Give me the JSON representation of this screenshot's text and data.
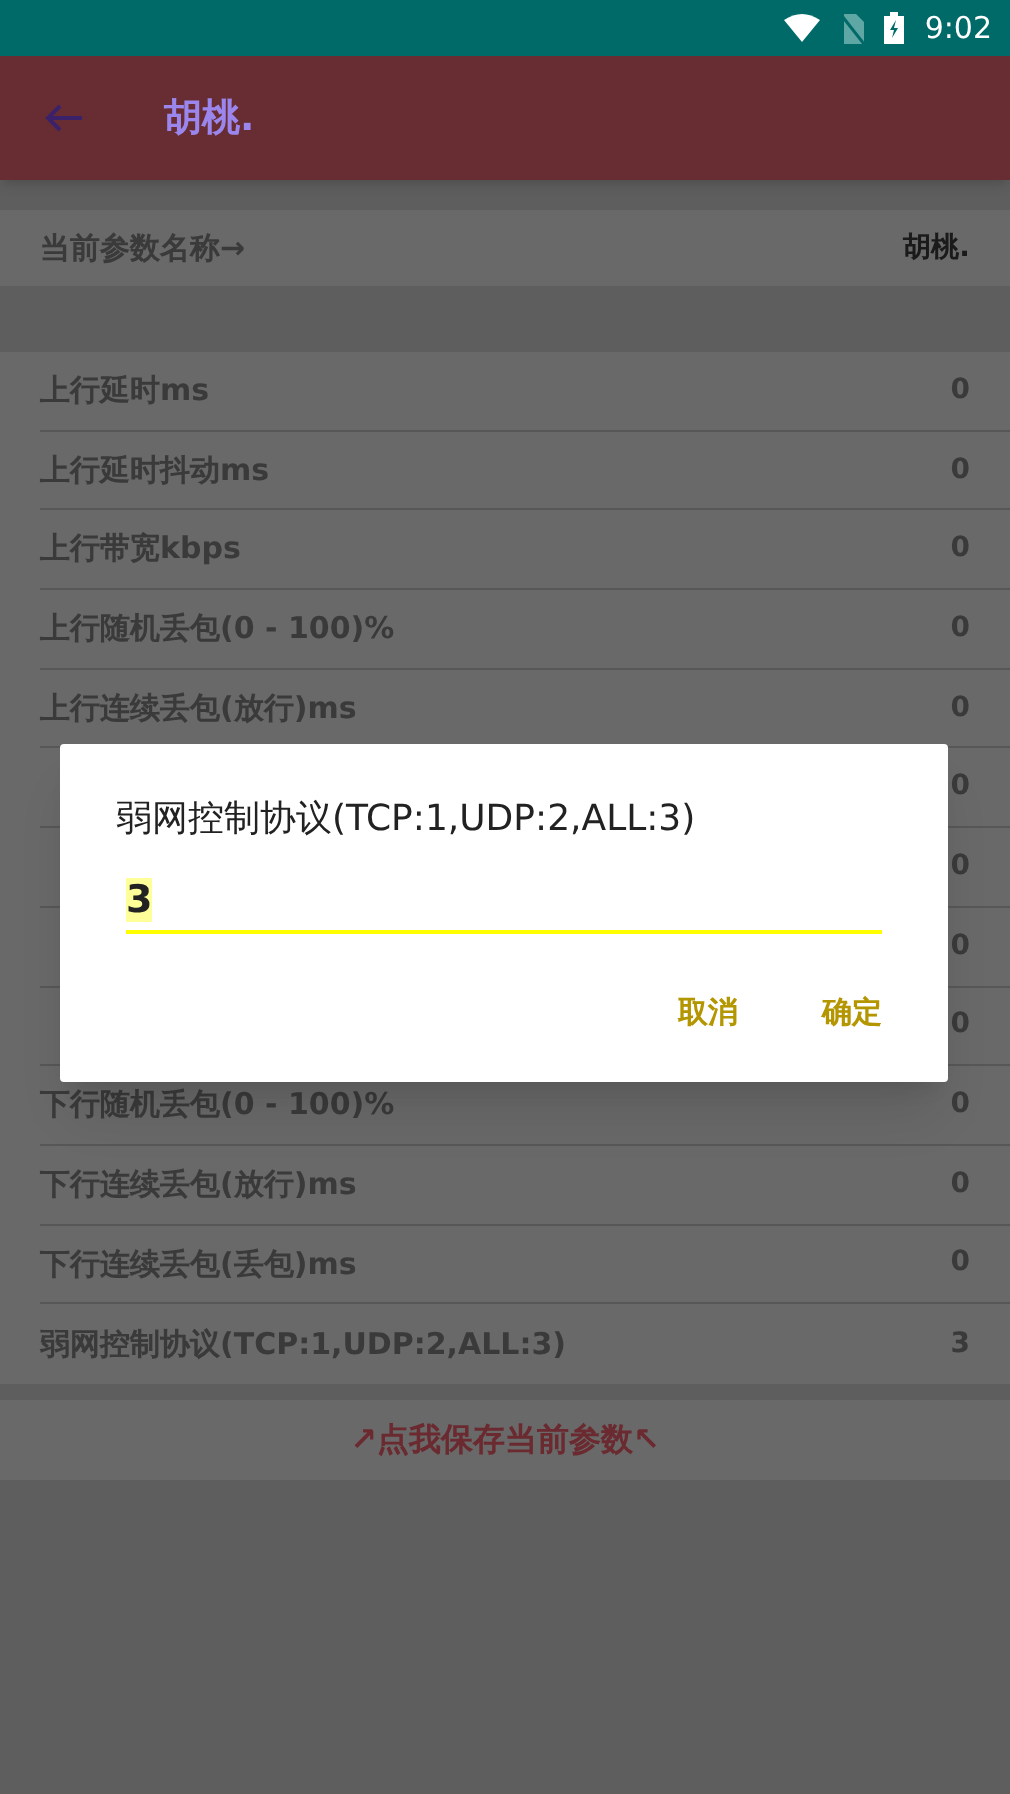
{
  "status_bar": {
    "time": "9:02"
  },
  "toolbar": {
    "title": "胡桃."
  },
  "current_name": {
    "label": "当前参数名称→",
    "value": "胡桃."
  },
  "params": [
    {
      "label": "上行延时ms",
      "value": "0"
    },
    {
      "label": "上行延时抖动ms",
      "value": "0"
    },
    {
      "label": "上行带宽kbps",
      "value": "0"
    },
    {
      "label": "上行随机丢包(0 - 100)%",
      "value": "0"
    },
    {
      "label": "上行连续丢包(放行)ms",
      "value": "0"
    },
    {
      "value": "0"
    },
    {
      "value": "0"
    },
    {
      "value": "0"
    },
    {
      "value": "0"
    },
    {
      "label": "下行随机丢包(0 - 100)%",
      "value": "0"
    },
    {
      "label": "下行连续丢包(放行)ms",
      "value": "0"
    },
    {
      "label": "下行连续丢包(丢包)ms",
      "value": "0"
    },
    {
      "label": "弱网控制协议(TCP:1,UDP:2,ALL:3)",
      "value": "3"
    }
  ],
  "save_button": "↗点我保存当前参数↖",
  "dialog": {
    "title": "弱网控制协议(TCP:1,UDP:2,ALL:3)",
    "value": "3",
    "buttons": [
      "取消",
      "确定"
    ]
  }
}
